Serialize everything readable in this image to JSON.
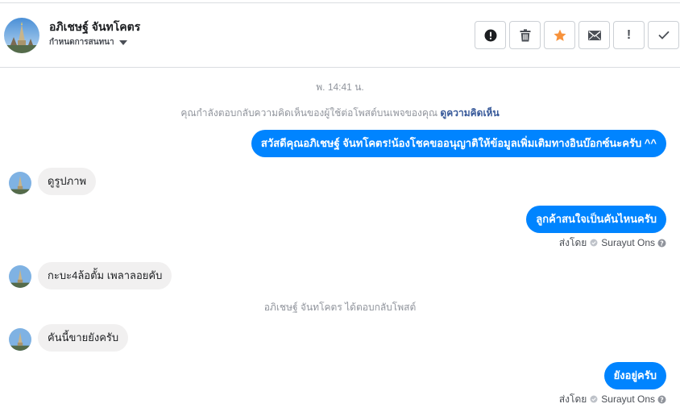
{
  "header": {
    "name": "อภิเชษฐ์ จันทโคตร",
    "assign_label": "กำหนดการสนทนา",
    "actions": [
      "mark-spam",
      "delete",
      "star",
      "mark-unread",
      "important",
      "done"
    ],
    "important_glyph": "!"
  },
  "conversation": {
    "timestamp": "พ. 14:41 น.",
    "system_reply_prefix": "คุณกำลังตอบกลับความคิดเห็นของผู้ใช้ต่อโพสต์บนเพจของคุณ",
    "system_reply_link": "ดูความคิดเห็น",
    "system_user_replied": "อภิเชษฐ์ จันทโคตร ได้ตอบกลับโพสต์",
    "messages": [
      {
        "from": "page",
        "text": "สวัสดีคุณอภิเชษฐ์ จันทโคตร!น้องโชคขออนุญาติให้ข้อมูลเพิ่มเติมทางอินบ๊อกซ์นะครับ ^^"
      },
      {
        "from": "user",
        "text": "ดูรูปภาพ"
      },
      {
        "from": "page",
        "text": "ลูกค้าสนใจเป็นคันไหนครับ",
        "sent_by_label": "ส่งโดย",
        "sent_by_name": "Surayut Ons"
      },
      {
        "from": "user",
        "text": "กะบะ4ล้อตั้ม เพลาลอยคับ"
      },
      {
        "from": "user",
        "text": "คันนี้ขายยังครับ"
      },
      {
        "from": "page",
        "text": "ยังอยู่ครับ",
        "sent_by_label": "ส่งโดย",
        "sent_by_name": "Surayut Ons"
      }
    ]
  },
  "colors": {
    "accent": "#0084ff",
    "star": "#f7923b",
    "incoming_bubble": "#f1f0f0",
    "muted_text": "#90949c",
    "link": "#365899"
  }
}
